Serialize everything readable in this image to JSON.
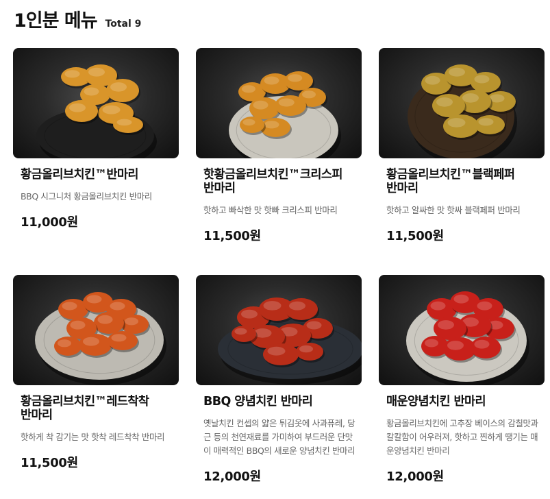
{
  "header": {
    "title": "1인분 메뉴",
    "total": "Total 9"
  },
  "menu": [
    {
      "name": "황금올리브치킨™반마리",
      "description": "BBQ 시그니처 황금올리브치킨 반마리",
      "price": "11,000원",
      "image": "golden-olive-fried-chicken-photo",
      "chicken_color": "#d9952a"
    },
    {
      "name": "핫황금올리브치킨™크리스피 반마리",
      "description": "핫하고 빠삭한 맛 핫빠 크리스피 반마리",
      "price": "11,500원",
      "image": "hot-crispy-fried-chicken-photo",
      "chicken_color": "#d58a22"
    },
    {
      "name": "황금올리브치킨™블랙페퍼 반마리",
      "description": "핫하고 알싸한 맛 핫싸 블랙페퍼 반마리",
      "price": "11,500원",
      "image": "black-pepper-fried-chicken-photo",
      "chicken_color": "#b9942e"
    },
    {
      "name": "황금올리브치킨™레드착착 반마리",
      "description": "핫하게 착 감기는 맛 핫착 레드착착 반마리",
      "price": "11,500원",
      "image": "red-seasoned-fried-chicken-photo",
      "chicken_color": "#d2561c"
    },
    {
      "name": "BBQ 양념치킨 반마리",
      "description": "옛날치킨 컨셉의 얇은 튀김옷에 사과퓨레, 당근 등의 천연재료를 가미하여 부드러운 단맛이 매력적인 BBQ의 새로운 양념치킨 반마리",
      "price": "12,000원",
      "image": "sweet-sauce-chicken-photo",
      "chicken_color": "#b82d18"
    },
    {
      "name": "매운양념치킨 반마리",
      "description": "황금올리브치킨에 고추장 베이스의 감칠맛과 칼칼함이 어우러져, 핫하고 찐하게 땡기는 매운양념치킨 반마리",
      "price": "12,000원",
      "image": "spicy-sauce-chicken-photo",
      "chicken_color": "#c8201a"
    }
  ]
}
